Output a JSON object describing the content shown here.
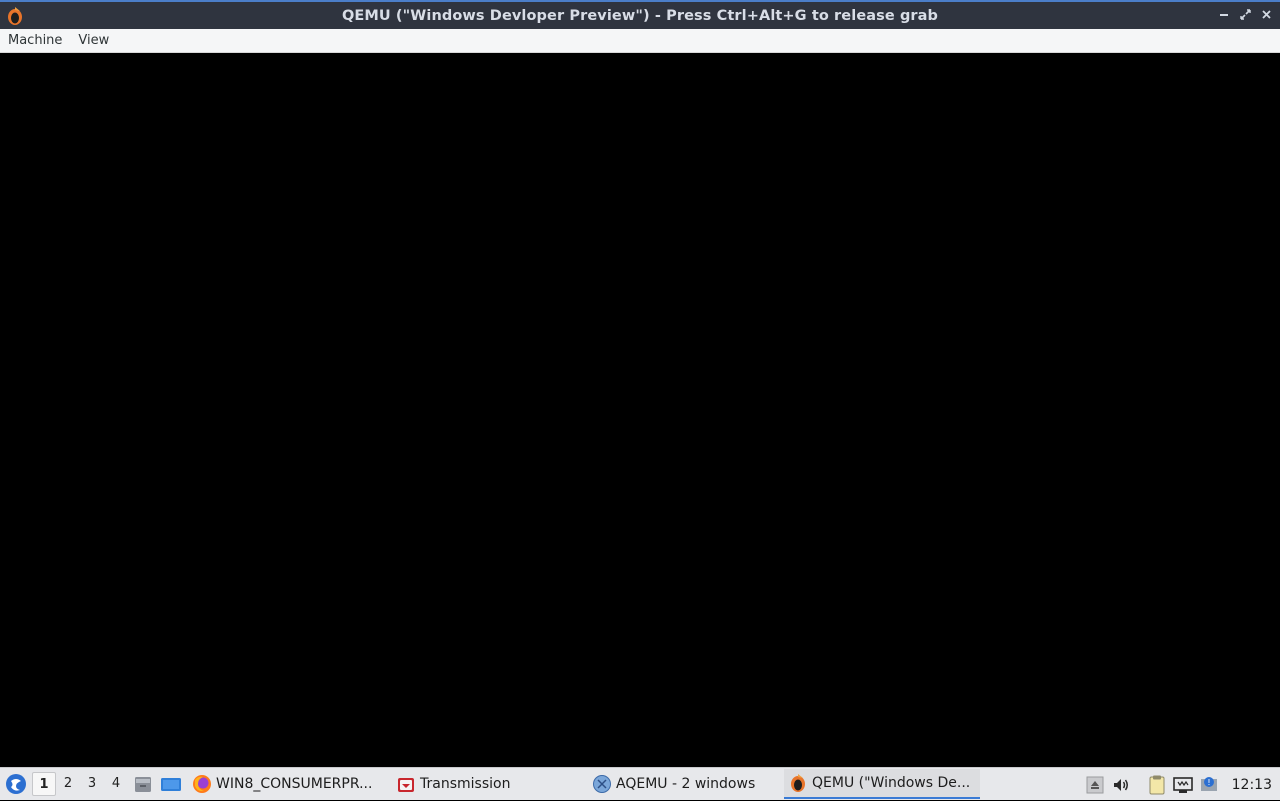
{
  "window": {
    "title": "QEMU (\"Windows Devloper Preview\") - Press Ctrl+Alt+G to release grab",
    "app_icon": "qemu-icon",
    "buttons": [
      "minimize-icon",
      "maximize-icon",
      "close-icon"
    ]
  },
  "menubar": {
    "items": [
      {
        "label": "Machine"
      },
      {
        "label": "View"
      }
    ]
  },
  "guest": {
    "state": "black screen"
  },
  "taskbar": {
    "start_icon": "start-menu-icon",
    "desktops": [
      {
        "label": "1",
        "active": true
      },
      {
        "label": "2"
      },
      {
        "label": "3"
      },
      {
        "label": "4"
      }
    ],
    "quick_launch": [
      "file-manager-icon",
      "show-desktop-icon"
    ],
    "tasks": [
      {
        "label": "WIN8_CONSUMERPR...",
        "icon": "firefox-icon",
        "active": false
      },
      {
        "label": "Transmission",
        "icon": "transmission-icon",
        "active": false
      },
      {
        "label": "AQEMU - 2 windows",
        "icon": "aqemu-icon",
        "active": false
      },
      {
        "label": "QEMU (\"Windows De...",
        "icon": "qemu-icon",
        "active": true
      }
    ],
    "tray": [
      "eject-icon",
      "volume-icon",
      "clipboard-icon",
      "network-icon",
      "updates-icon"
    ],
    "clock": "12:13"
  },
  "colors": {
    "titlebar_bg": "#2f343f",
    "accent": "#3a7bd5",
    "taskbar_bg": "#e7e8eb"
  }
}
